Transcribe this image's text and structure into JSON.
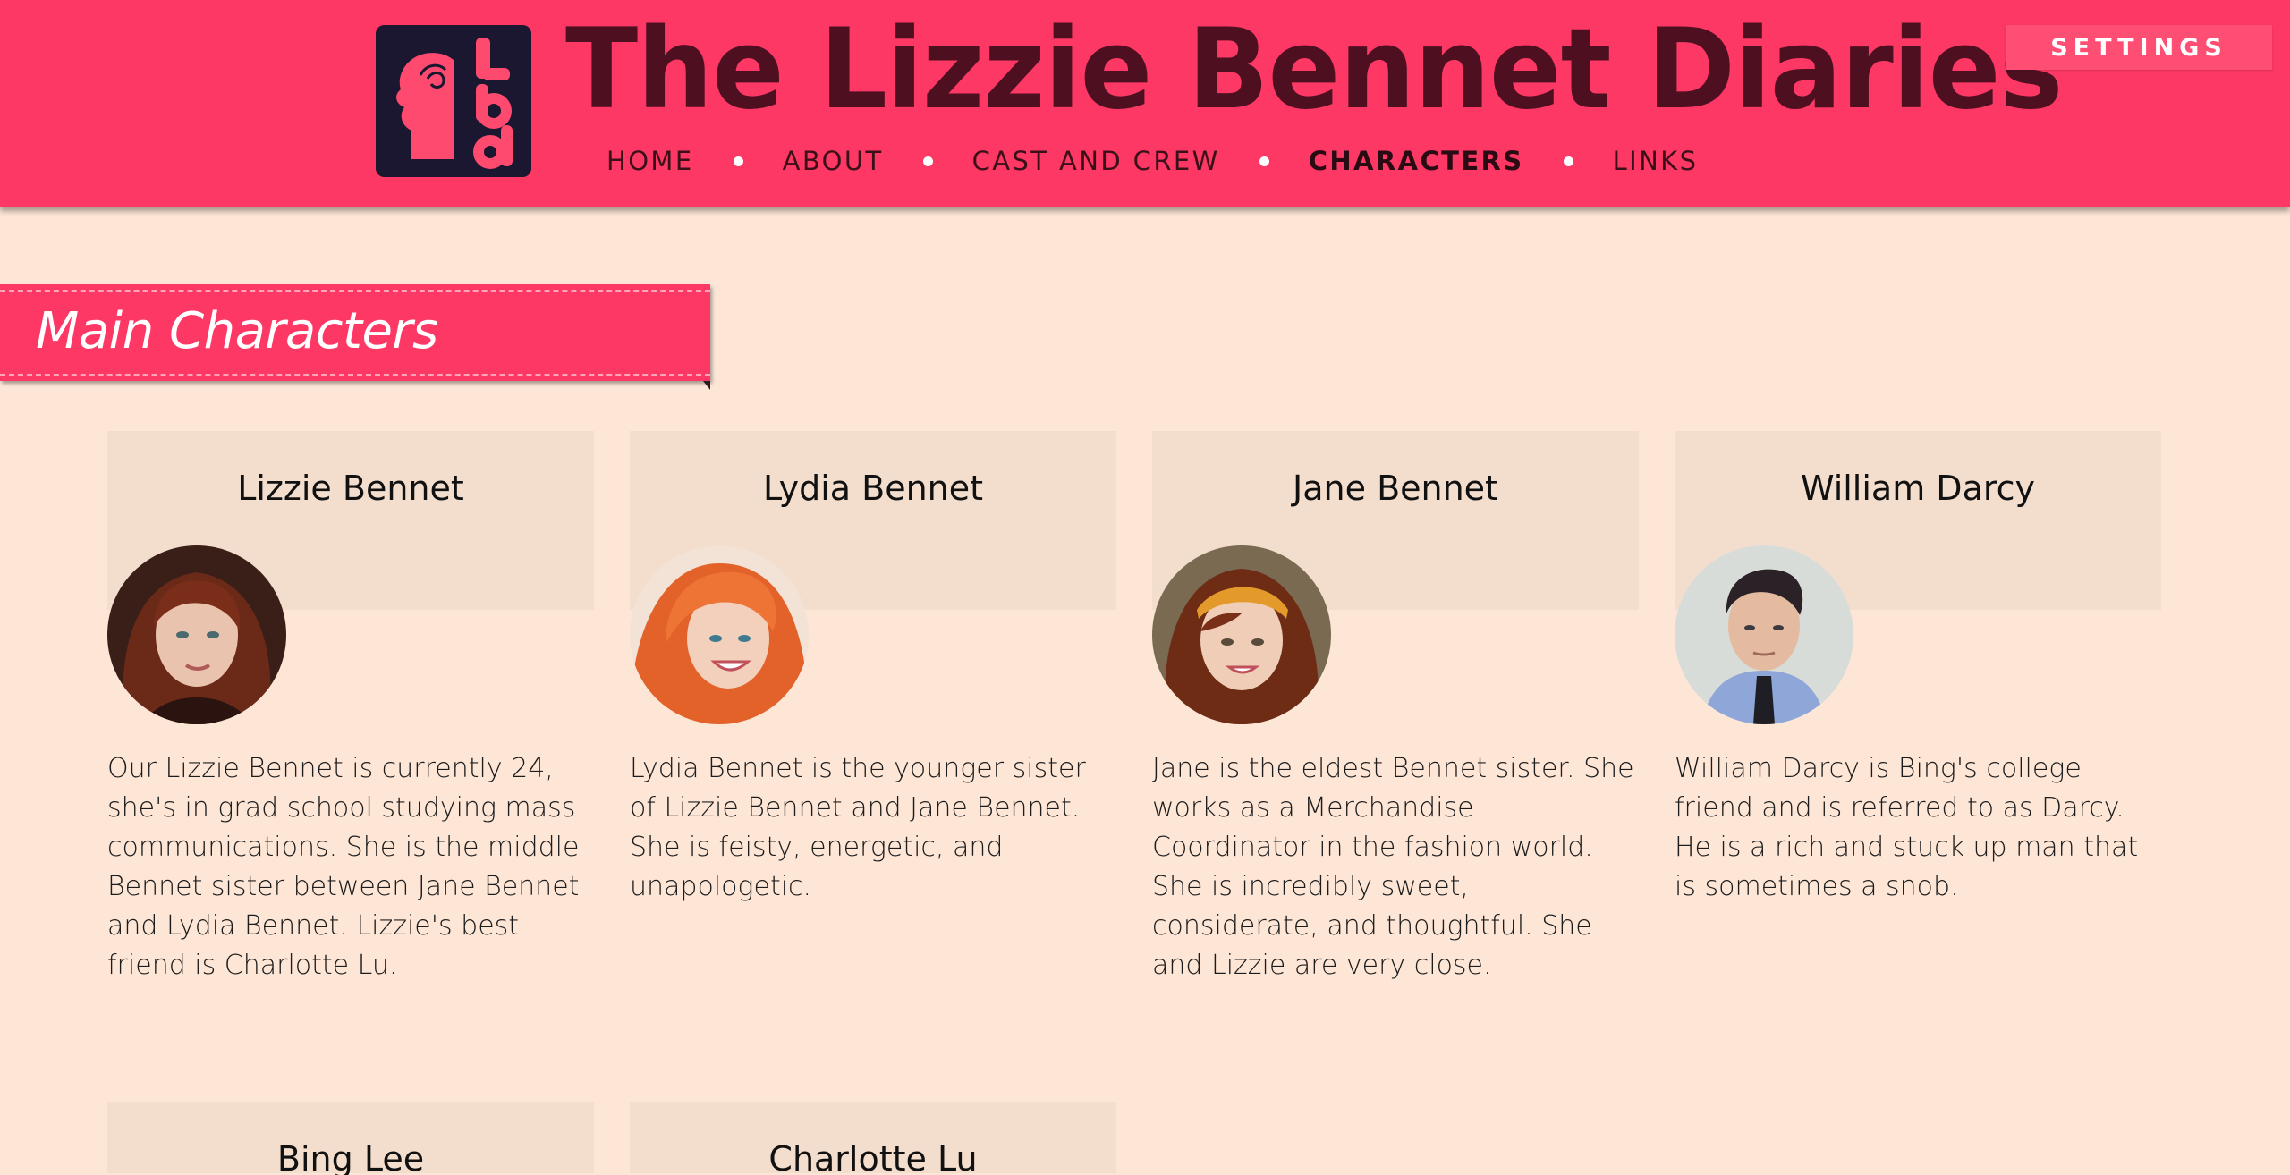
{
  "site": {
    "title": "The Lizzie Bennet Diaries",
    "logo_letters": "lbd",
    "settings_label": "SETTINGS"
  },
  "nav": {
    "items": [
      {
        "label": "HOME",
        "active": false
      },
      {
        "label": "ABOUT",
        "active": false
      },
      {
        "label": "CAST AND CREW",
        "active": false
      },
      {
        "label": "CHARACTERS",
        "active": true
      },
      {
        "label": "LINKS",
        "active": false
      }
    ]
  },
  "section": {
    "title": "Main Characters"
  },
  "characters": [
    {
      "name": "Lizzie Bennet",
      "description": "Our Lizzie Bennet is currently 24, she's in grad school studying mass communications. She is the middle Bennet sister between Jane Bennet and Lydia Bennet. Lizzie's best friend is Charlotte Lu."
    },
    {
      "name": "Lydia Bennet",
      "description": "Lydia Bennet is the younger sister of Lizzie Bennet and Jane Bennet. She is feisty, energetic, and unapologetic."
    },
    {
      "name": "Jane Bennet",
      "description": "Jane is the eldest Bennet sister. She works as a Merchandise Coordinator in the fashion world. She is incredibly sweet, considerate, and thoughtful. She and Lizzie are very close."
    },
    {
      "name": "William Darcy",
      "description": "William Darcy is Bing's college friend and is referred to as Darcy. He is a rich and stuck up man that is sometimes a snob."
    },
    {
      "name": "Bing Lee",
      "description": ""
    },
    {
      "name": "Charlotte Lu",
      "description": ""
    }
  ],
  "colors": {
    "header_bg": "#fd3864",
    "page_bg": "#fee6d7",
    "card_head_bg": "#f3dece",
    "title_color": "#4e1021",
    "logo_bg": "#1c1730"
  }
}
